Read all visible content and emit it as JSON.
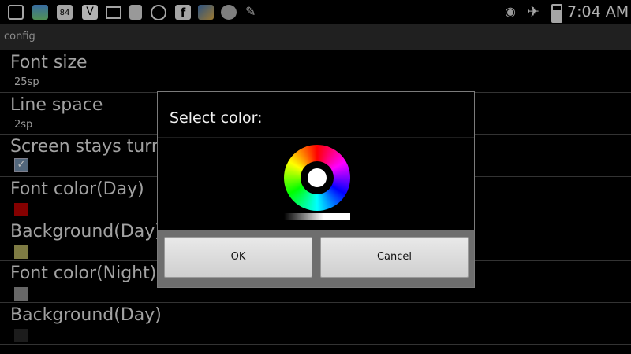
{
  "status_bar": {
    "time": "7:04 AM",
    "notif_text_84": "84",
    "icons": [
      "notification-icon",
      "gallery-icon",
      "calendar-icon",
      "vine-icon",
      "email-icon",
      "file-icon",
      "whatsapp-icon",
      "facebook-icon",
      "photo-icon",
      "sync-icon",
      "pen-icon",
      "eye-icon",
      "airplane-icon",
      "battery-icon"
    ]
  },
  "action_bar": {
    "title": "config"
  },
  "settings": {
    "rows": [
      {
        "title": "Font size",
        "summary": "25sp"
      },
      {
        "title": "Line space",
        "summary": "2sp"
      },
      {
        "title": "Screen stays turn on",
        "checked": true
      },
      {
        "title": "Font color(Day)",
        "swatch": "#b00000"
      },
      {
        "title": "Background(Day)",
        "swatch": "#a9a45a"
      },
      {
        "title": "Font color(Night)",
        "swatch": "#8a8a8a"
      },
      {
        "title": "Background(Day)",
        "swatch": "#262626"
      }
    ]
  },
  "dialog": {
    "title": "Select color:",
    "ok_label": "OK",
    "cancel_label": "Cancel",
    "selected_color": "#ffffff"
  }
}
